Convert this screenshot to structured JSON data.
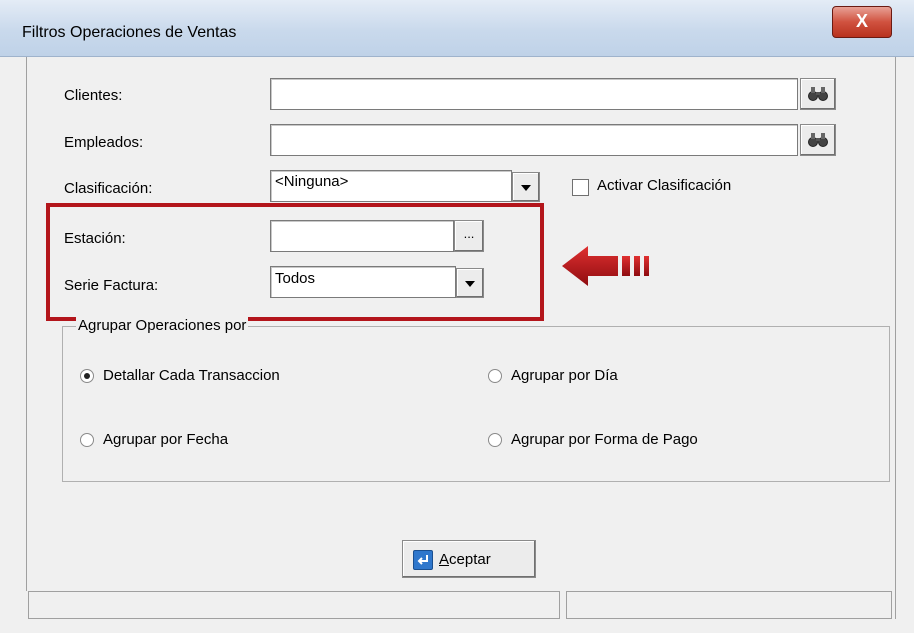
{
  "window": {
    "title": "Filtros Operaciones de Ventas",
    "close_label": "X"
  },
  "labels": {
    "clientes": "Clientes:",
    "empleados": "Empleados:",
    "clasificacion": "Clasificación:",
    "estacion": "Estación:",
    "serie_factura": "Serie Factura:"
  },
  "fields": {
    "clientes_value": "",
    "empleados_value": "",
    "estacion_value": "",
    "clasificacion_value": "<Ninguna>",
    "serie_factura_value": "Todos",
    "estacion_browse_label": "..."
  },
  "checkbox": {
    "activar_clasificacion_label": "Activar Clasificación",
    "checked": false
  },
  "group": {
    "title": "Agrupar Operaciones por",
    "options": [
      {
        "label": "Detallar Cada Transaccion",
        "selected": true
      },
      {
        "label": "Agrupar por  Día",
        "selected": false
      },
      {
        "label": "Agrupar por  Fecha",
        "selected": false
      },
      {
        "label": "Agrupar por  Forma de Pago",
        "selected": false
      }
    ]
  },
  "buttons": {
    "aceptar_mnemonic": "A",
    "aceptar_rest": "ceptar"
  },
  "icons": {
    "search": "binoculars-icon",
    "dropdown": "chevron-down-icon",
    "enter": "enter-icon",
    "annotation": "red-arrow-icon"
  },
  "colors": {
    "highlight": "#b3151b",
    "arrow": "#c0141a",
    "title_bg": "#c9d9ec",
    "close_bg": "#c8402f"
  }
}
